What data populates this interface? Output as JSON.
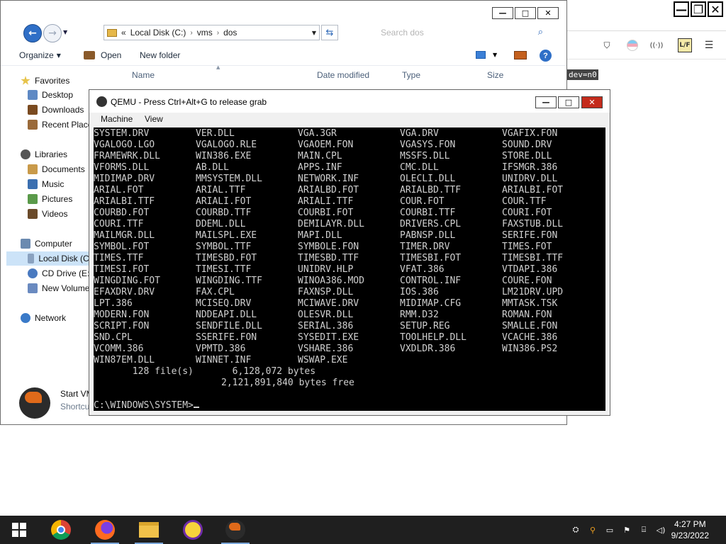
{
  "browser": {
    "window_controls": {
      "minimize": "—",
      "restore": "❐",
      "close": "✕"
    },
    "address_fragment": "dev=n0",
    "toolbar_icons": [
      "pocket-icon",
      "extension-icon",
      "audio-icon",
      "lf-extension-icon",
      "menu-icon"
    ],
    "lf_label": "L/F",
    "audio_label": "((·))"
  },
  "explorer": {
    "window_controls": {
      "minimize": "—",
      "maximize": "□",
      "close": "✕"
    },
    "address": {
      "chevron": "«",
      "segments": [
        "Local Disk (C:)",
        "vms",
        "dos"
      ],
      "separators": [
        "›",
        "›"
      ]
    },
    "search_placeholder": "Search dos",
    "commands": {
      "organize": "Organize",
      "open": "Open",
      "new_folder": "New folder",
      "help": "?"
    },
    "columns": [
      "Name",
      "Date modified",
      "Type",
      "Size"
    ],
    "nav": {
      "favorites": "Favorites",
      "desktop": "Desktop",
      "downloads": "Downloads",
      "recent": "Recent Places",
      "libraries": "Libraries",
      "documents": "Documents",
      "music": "Music",
      "pictures": "Pictures",
      "videos": "Videos",
      "computer": "Computer",
      "local_disk": "Local Disk (C:)",
      "cd_drive": "CD Drive (E:)",
      "new_volume": "New Volume",
      "network": "Network"
    },
    "details": {
      "title": "Start VM",
      "subtitle": "Shortcut"
    }
  },
  "qemu": {
    "title": "QEMU - Press Ctrl+Alt+G to release grab",
    "window_controls": {
      "minimize": "—",
      "maximize": "□",
      "close": "✕"
    },
    "menu": [
      "Machine",
      "View"
    ],
    "listing": [
      [
        "SYSTEM.DRV",
        "VER.DLL",
        "VGA.3GR",
        "VGA.DRV",
        "VGAFIX.FON"
      ],
      [
        "VGALOGO.LGO",
        "VGALOGO.RLE",
        "VGAOEM.FON",
        "VGASYS.FON",
        "SOUND.DRV"
      ],
      [
        "FRAMEWRK.DLL",
        "WIN386.EXE",
        "MAIN.CPL",
        "MSSFS.DLL",
        "STORE.DLL"
      ],
      [
        "VFORMS.DLL",
        "AB.DLL",
        "APPS.INF",
        "CMC.DLL",
        "IFSMGR.386"
      ],
      [
        "MIDIMAP.DRV",
        "MMSYSTEM.DLL",
        "NETWORK.INF",
        "OLECLI.DLL",
        "UNIDRV.DLL"
      ],
      [
        "ARIAL.FOT",
        "ARIAL.TTF",
        "ARIALBD.FOT",
        "ARIALBD.TTF",
        "ARIALBI.FOT"
      ],
      [
        "ARIALBI.TTF",
        "ARIALI.FOT",
        "ARIALI.TTF",
        "COUR.FOT",
        "COUR.TTF"
      ],
      [
        "COURBD.FOT",
        "COURBD.TTF",
        "COURBI.FOT",
        "COURBI.TTF",
        "COURI.FOT"
      ],
      [
        "COURI.TTF",
        "DDEML.DLL",
        "DEMILAYR.DLL",
        "DRIVERS.CPL",
        "FAXSTUB.DLL"
      ],
      [
        "MAILMGR.DLL",
        "MAILSPL.EXE",
        "MAPI.DLL",
        "PABNSP.DLL",
        "SERIFE.FON"
      ],
      [
        "SYMBOL.FOT",
        "SYMBOL.TTF",
        "SYMBOLE.FON",
        "TIMER.DRV",
        "TIMES.FOT"
      ],
      [
        "TIMES.TTF",
        "TIMESBD.FOT",
        "TIMESBD.TTF",
        "TIMESBI.FOT",
        "TIMESBI.TTF"
      ],
      [
        "TIMESI.FOT",
        "TIMESI.TTF",
        "UNIDRV.HLP",
        "VFAT.386",
        "VTDAPI.386"
      ],
      [
        "WINGDING.FOT",
        "WINGDING.TTF",
        "WINOA386.MOD",
        "CONTROL.INF",
        "COURE.FON"
      ],
      [
        "EFAXDRV.DRV",
        "FAX.CPL",
        "FAXNSP.DLL",
        "IOS.386",
        "LM21DRV.UPD"
      ],
      [
        "LPT.386",
        "MCISEQ.DRV",
        "MCIWAVE.DRV",
        "MIDIMAP.CFG",
        "MMTASK.TSK"
      ],
      [
        "MODERN.FON",
        "NDDEAPI.DLL",
        "OLESVR.DLL",
        "RMM.D32",
        "ROMAN.FON"
      ],
      [
        "SCRIPT.FON",
        "SENDFILE.DLL",
        "SERIAL.386",
        "SETUP.REG",
        "SMALLE.FON"
      ],
      [
        "SND.CPL",
        "SSERIFE.FON",
        "SYSEDIT.EXE",
        "TOOLHELP.DLL",
        "VCACHE.386"
      ],
      [
        "VCOMM.386",
        "VPMTD.386",
        "VSHARE.386",
        "VXDLDR.386",
        "WIN386.PS2"
      ],
      [
        "WIN87EM.DLL",
        "WINNET.INF",
        "WSWAP.EXE",
        "",
        ""
      ]
    ],
    "summary": {
      "files_line": "       128 file(s)       6,128,072 bytes",
      "free_line": "                       2,121,891,840 bytes free"
    },
    "prompt": "C:\\WINDOWS\\SYSTEM>"
  },
  "taskbar": {
    "apps": [
      "start-icon",
      "chrome-icon",
      "firefox-icon",
      "file-explorer-icon",
      "yahoo-messenger-icon",
      "qemu-icon"
    ],
    "tray": {
      "time": "4:27 PM",
      "date": "9/23/2022"
    }
  },
  "colors": {
    "dos_bg": "#000000",
    "dos_fg": "#d0d0d0",
    "taskbar": "#1f1f1f",
    "selection": "#cce3f8",
    "close_red": "#c42b1c",
    "accent_blue": "#2f6fc7"
  }
}
